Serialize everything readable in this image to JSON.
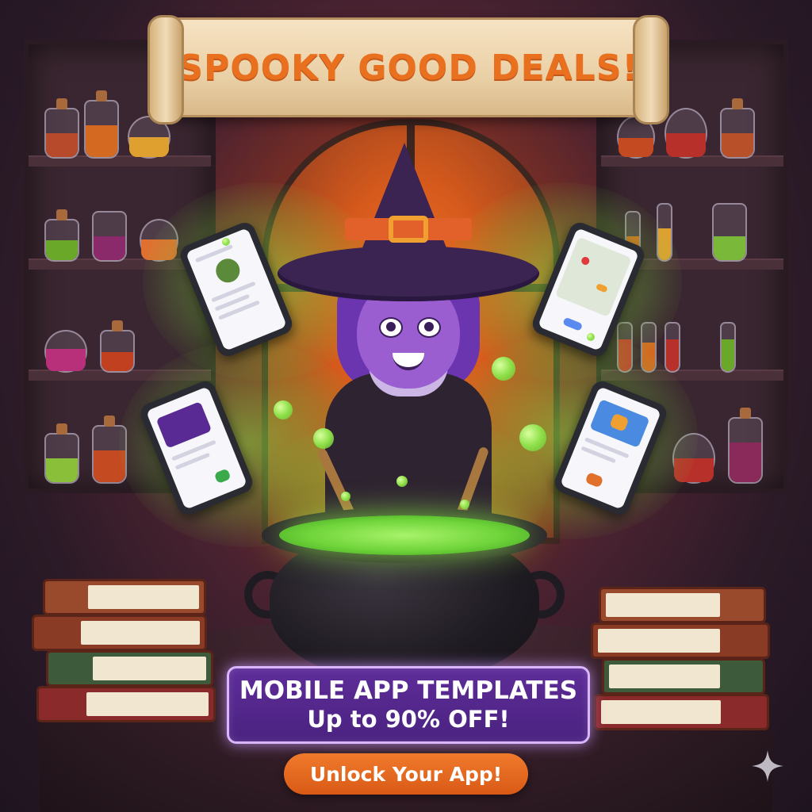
{
  "banner": {
    "title": "SPOOKY GOOD DEALS!"
  },
  "promo": {
    "line1": "MOBILE APP TEMPLATES",
    "line2": "Up to 90% OFF!"
  },
  "cta": {
    "label": "Unlock Your App!"
  },
  "colors": {
    "accent": "#e8701e",
    "promo_bg": "#5a2a94",
    "brew": "#7fe04a",
    "cta": "#e8691f"
  },
  "icons": {
    "corner": "sparkle-icon"
  }
}
